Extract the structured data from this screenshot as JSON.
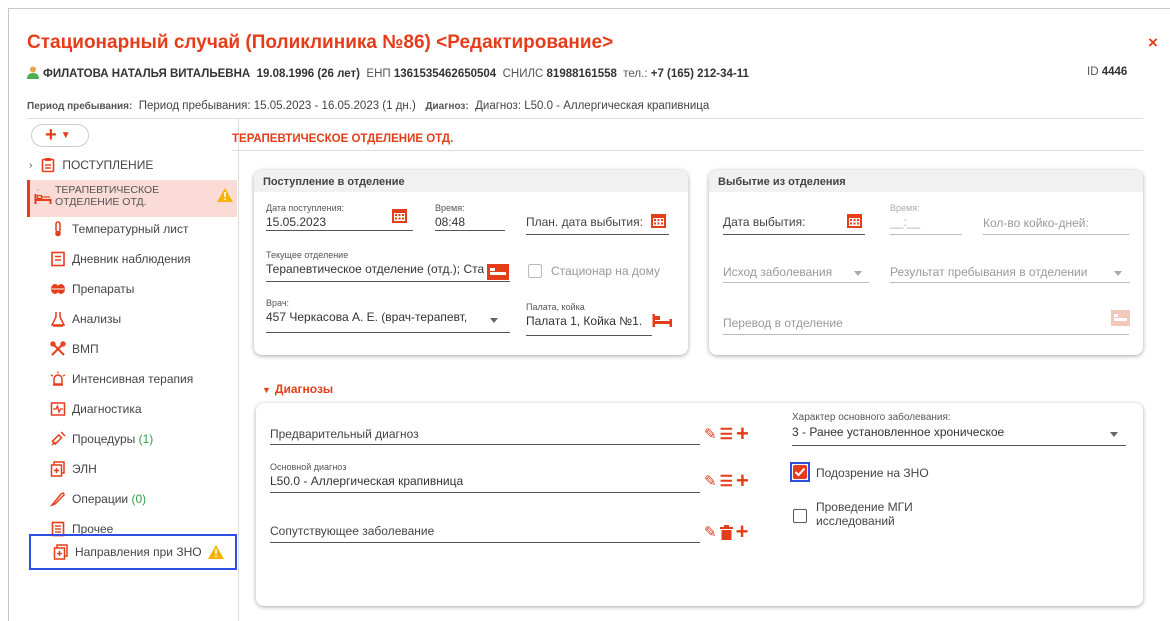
{
  "window": {
    "title": "Стационарный случай (Поликлиника №86) <Редактирование>",
    "close_label": "×"
  },
  "patient": {
    "name": "ФИЛАТОВА НАТАЛЬЯ ВИТАЛЬЕВНА",
    "birth": "19.08.1996 (26 лет)",
    "enp_label": "ЕНП",
    "enp": "1361535462650504",
    "snils_label": "СНИЛС",
    "snils": "81988161558",
    "phone_label": "тел.:",
    "phone": "+7 (165) 212-34-11",
    "id_label": "ID",
    "id": "4446"
  },
  "period": {
    "period_caption": "Период пребывания:",
    "period_text": "Период пребывания: 15.05.2023 - 16.05.2023 (1 дн.)",
    "diag_caption": "Диагноз:",
    "diag_text": "Диагноз: L50.0 - Аллергическая крапивница"
  },
  "sidebar": {
    "add_label": "+",
    "items": [
      {
        "label": "ПОСТУПЛЕНИЕ"
      },
      {
        "label": "ТЕРАПЕВТИЧЕСКОЕ ОТДЕЛЕНИЕ ОТД."
      },
      {
        "label": "Температурный лист"
      },
      {
        "label": "Дневник наблюдения"
      },
      {
        "label": "Препараты"
      },
      {
        "label": "Анализы"
      },
      {
        "label": "ВМП"
      },
      {
        "label": "Интенсивная терапия"
      },
      {
        "label": "Диагностика"
      },
      {
        "label": "Процедуры",
        "count": "(1)"
      },
      {
        "label": "ЭЛН"
      },
      {
        "label": "Операции",
        "count": "(0)"
      },
      {
        "label": "Прочее"
      },
      {
        "label": "Направления при ЗНО"
      }
    ]
  },
  "main": {
    "section_title": "ТЕРАПЕВТИЧЕСКОЕ ОТДЕЛЕНИЕ ОТД.",
    "admission": {
      "header": "Поступление в отделение",
      "date_caption": "Дата поступления:",
      "date_value": "15.05.2023",
      "time_caption": "Время:",
      "time_value": "08:48",
      "plan_discharge": "План. дата выбытия:",
      "dept_caption": "Текущее отделение",
      "dept_value": "Терапевтическое отделение (отд.); Ста",
      "home_hospital": "Стационар на дому",
      "doctor_caption": "Врач:",
      "doctor_value": "457 Черкасова А. Е. (врач-терапевт,",
      "ward_caption": "Палата, койка",
      "ward_value": "Палата 1, Койка №1."
    },
    "discharge": {
      "header": "Выбытие из отделения",
      "date": "Дата выбытия:",
      "time_caption": "Время:",
      "time_placeholder": "__:__",
      "bed_days": "Кол-во койко-дней:",
      "outcome": "Исход заболевания",
      "result": "Результат пребывания в отделении",
      "transfer": "Перевод в отделение"
    },
    "diagnoses": {
      "toggle": "Диагнозы",
      "preliminary": "Предварительный диагноз",
      "main_caption": "Основной диагноз",
      "main_value": "L50.0 - Аллергическая крапивница",
      "concomitant": "Сопутствующее заболевание",
      "character_caption": "Характер основного заболевания:",
      "character_value": "3 - Ранее установленное хроническое",
      "zno_suspicion": "Подозрение на ЗНО",
      "mgi": "Проведение МГИ исследований"
    }
  },
  "colors": {
    "accent": "#e53d1a",
    "warning": "#f5b400",
    "highlight": "#2f4de0"
  }
}
